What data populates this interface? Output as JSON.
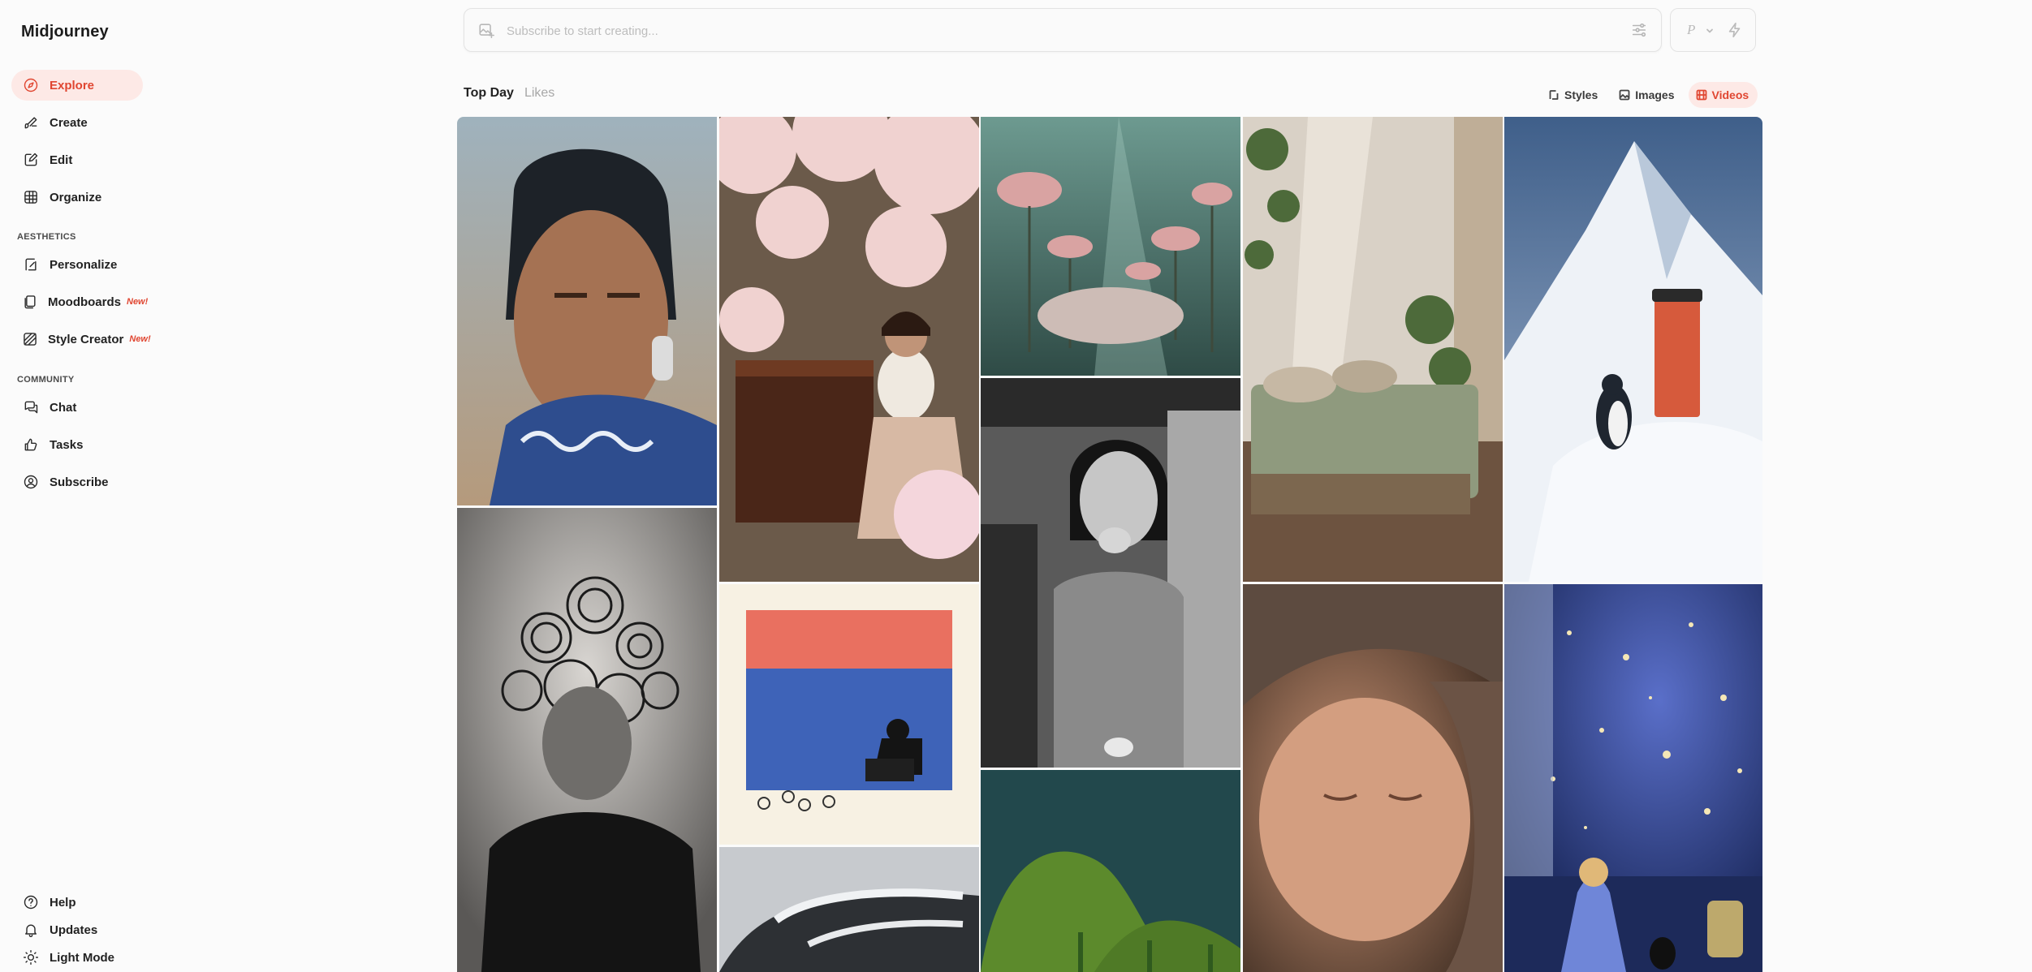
{
  "app": {
    "brand": "Midjourney"
  },
  "sidebar": {
    "items": [
      {
        "label": "Explore",
        "icon": "compass-icon",
        "active": true
      },
      {
        "label": "Create",
        "icon": "brush-icon"
      },
      {
        "label": "Edit",
        "icon": "edit-icon"
      },
      {
        "label": "Organize",
        "icon": "grid-icon"
      }
    ],
    "aesthetics_heading": "AESTHETICS",
    "aesthetics": [
      {
        "label": "Personalize",
        "icon": "personalize-icon"
      },
      {
        "label": "Moodboards",
        "icon": "moodboard-icon",
        "badge": "New!"
      },
      {
        "label": "Style Creator",
        "icon": "style-creator-icon",
        "badge": "New!"
      }
    ],
    "community_heading": "COMMUNITY",
    "community": [
      {
        "label": "Chat",
        "icon": "chat-icon"
      },
      {
        "label": "Tasks",
        "icon": "thumbs-up-icon"
      },
      {
        "label": "Subscribe",
        "icon": "user-circle-icon"
      }
    ],
    "footer": [
      {
        "label": "Help",
        "icon": "help-icon"
      },
      {
        "label": "Updates",
        "icon": "bell-icon"
      },
      {
        "label": "Light Mode",
        "icon": "sun-icon"
      }
    ]
  },
  "prompt": {
    "placeholder": "Subscribe to start creating...",
    "mode_letter": "P"
  },
  "tabs": {
    "top_day": "Top Day",
    "likes": "Likes"
  },
  "filters": {
    "styles": "Styles",
    "images": "Images",
    "videos": "Videos",
    "active": "Videos"
  },
  "colors": {
    "accent": "#e04631",
    "accent_bg": "#fde9e6"
  },
  "gallery": [
    "freckled-woman-portrait",
    "cherry-blossom-pianist",
    "underwater-flower-bed",
    "sunlit-bedroom",
    "penguin-coffee-cup-mountain",
    "spiral-hair-portrait",
    "child-drawing-flag",
    "laughing-woman-bw",
    "sleeping-baby",
    "starry-night-girl",
    "car-hood-closeup",
    "green-hills"
  ]
}
